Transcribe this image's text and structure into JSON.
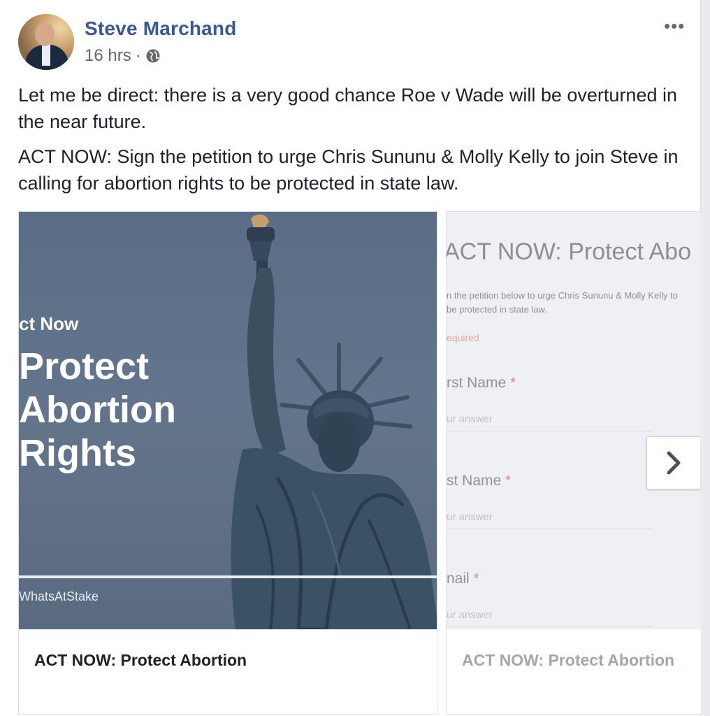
{
  "post": {
    "author": "Steve Marchand",
    "time": "16 hrs",
    "separator": "·",
    "audience_icon": "globe-icon",
    "menu_icon": "more-options-icon",
    "paragraphs": [
      "Let me be direct: there is a very good chance Roe v Wade will be overturned in the near future.",
      "ACT NOW: Sign the petition to urge Chris Sununu & Molly Kelly to join Steve in calling for abortion rights to be protected in state law."
    ]
  },
  "carousel": {
    "cards": [
      {
        "image_text": {
          "kicker": "ct Now",
          "line1": "Protect",
          "line2": "Abortion",
          "line3": "Rights",
          "hashtag": "WhatsAtStake"
        },
        "title": "ACT NOW: Protect Abortion"
      },
      {
        "form": {
          "title": "ACT NOW: Protect Abo",
          "desc_line1": "n the petition below to urge Chris Sununu & Molly Kelly to",
          "desc_line2": "be protected in state law.",
          "required_note": "equired",
          "fields": [
            {
              "label": "rst Name",
              "placeholder": "ur answer"
            },
            {
              "label": "st Name",
              "placeholder": "ur answer"
            },
            {
              "label": "nail",
              "placeholder": "ur answer"
            }
          ],
          "required_marker": "*"
        },
        "title": "ACT NOW: Protect Abortion"
      }
    ],
    "next_icon": "chevron-right-icon"
  },
  "colors": {
    "author_link": "#385898",
    "body_text": "#1d2129",
    "meta_text": "#616770"
  }
}
